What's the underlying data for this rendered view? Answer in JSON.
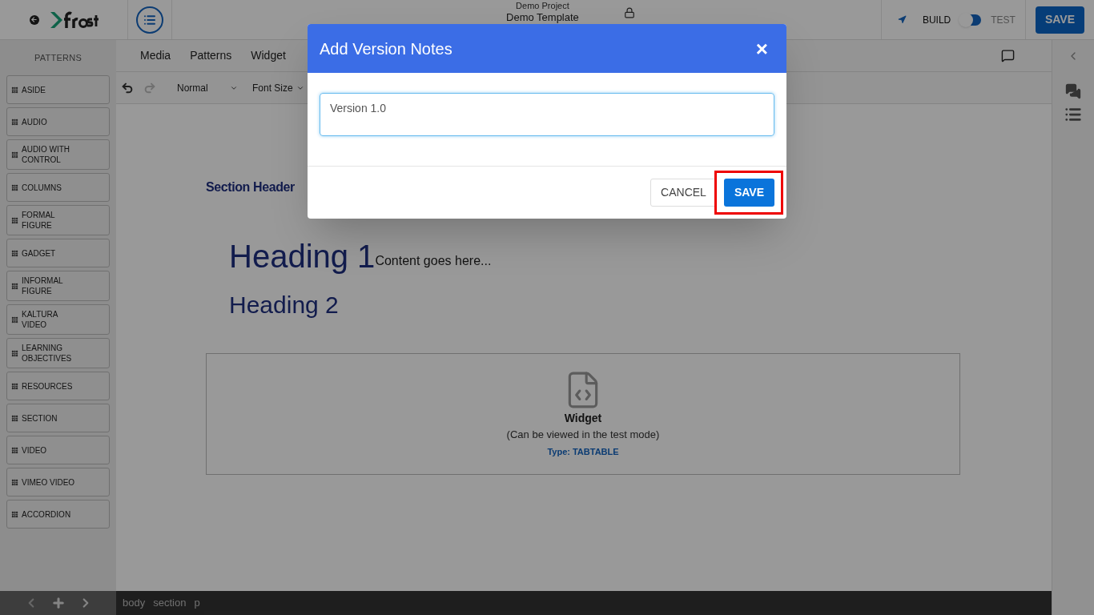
{
  "header": {
    "project": "Demo Project",
    "template": "Demo Template",
    "mode_left": "BUILD",
    "mode_right": "TEST",
    "test_mode": {
      "on": false
    },
    "save": "SAVE"
  },
  "patterns": {
    "title": "PATTERNS",
    "items": [
      {
        "label": "ASIDE"
      },
      {
        "label": "AUDIO"
      },
      {
        "label": "AUDIO WITH CONTROL"
      },
      {
        "label": "COLUMNS"
      },
      {
        "label": "FORMAL FIGURE"
      },
      {
        "label": "GADGET"
      },
      {
        "label": "INFORMAL FIGURE"
      },
      {
        "label": "KALTURA VIDEO"
      },
      {
        "label": "LEARNING OBJECTIVES"
      },
      {
        "label": "RESOURCES"
      },
      {
        "label": "SECTION"
      },
      {
        "label": "VIDEO"
      },
      {
        "label": "VIMEO VIDEO"
      },
      {
        "label": "ACCORDION"
      }
    ]
  },
  "menu": [
    "Media",
    "Patterns",
    "Widget"
  ],
  "toolbar": {
    "style": "Normal",
    "font_size": "Font Size"
  },
  "canvas": {
    "section_header": "Section Header",
    "heading_1": "Heading 1",
    "content": "Content goes here...",
    "heading_2": "Heading 2",
    "widget": {
      "title": "Widget",
      "note": "(Can be viewed in the test mode)",
      "type": "Type: TABTABLE"
    }
  },
  "breadcrumbs": [
    "body",
    "section",
    "p"
  ],
  "modal": {
    "title": "Add Version Notes",
    "close": "×",
    "notes_value": "Version 1.0",
    "cancel": "CANCEL",
    "save": "SAVE",
    "save_highlighted": true
  }
}
